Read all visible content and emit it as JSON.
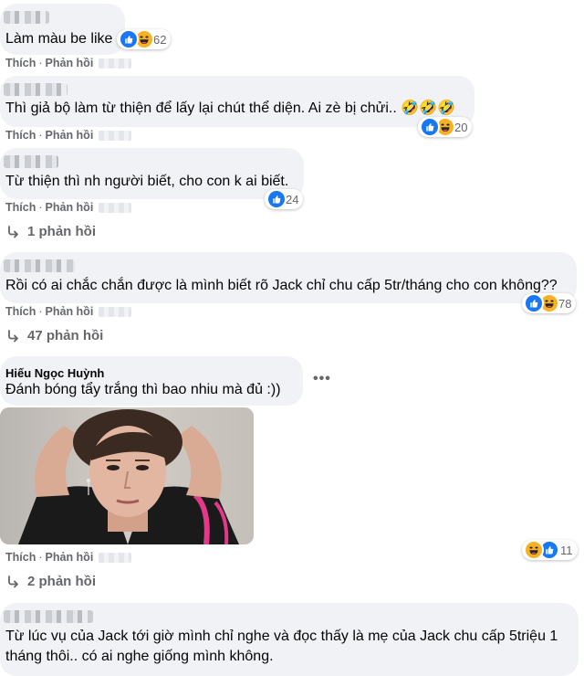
{
  "actions": {
    "like": "Thích",
    "reply": "Phản hồi",
    "sep": "·"
  },
  "colors": {
    "bubble": "#f0f2f5",
    "like": "#1877f2",
    "haha": "#f7b125",
    "meta": "#65676b"
  },
  "comments": [
    {
      "author_visible": false,
      "text": "Làm màu be like",
      "reactions": [
        "like-icon",
        "haha-icon"
      ],
      "reaction_count": "62"
    },
    {
      "author_visible": false,
      "text": "Thì giả bộ làm từ thiện để lấy lại chút thể diện. Ai zè bị chửi.. 🤣🤣🤣",
      "reactions": [
        "like-icon",
        "haha-icon"
      ],
      "reaction_count": "20"
    },
    {
      "author_visible": false,
      "text": "Từ thiện thì nh người biết, cho con k ai biết.",
      "reactions": [
        "like-icon"
      ],
      "reaction_count": "24",
      "replies": "1 phản hồi"
    },
    {
      "author_visible": false,
      "text": "Rồi có ai chắc chắn được là mình biết rõ Jack chỉ chu cấp 5tr/tháng cho con không??",
      "reactions": [
        "like-icon",
        "haha-icon"
      ],
      "reaction_count": "78",
      "replies": "47 phản hồi"
    },
    {
      "author": "Hiếu Ngọc Huỳnh",
      "text": "Đánh bóng tẩy trắng thì bao nhiu mà đủ :))",
      "more": "•••",
      "reactions": [
        "haha-icon",
        "like-icon"
      ],
      "reaction_count": "11",
      "replies": "2 phản hồi"
    },
    {
      "author_visible": false,
      "text": "Từ lúc vụ của Jack tới giờ mình chỉ nghe và đọc thấy là mẹ của Jack chu cấp 5triệu 1 tháng thôi.. có ai nghe giống mình không."
    }
  ]
}
